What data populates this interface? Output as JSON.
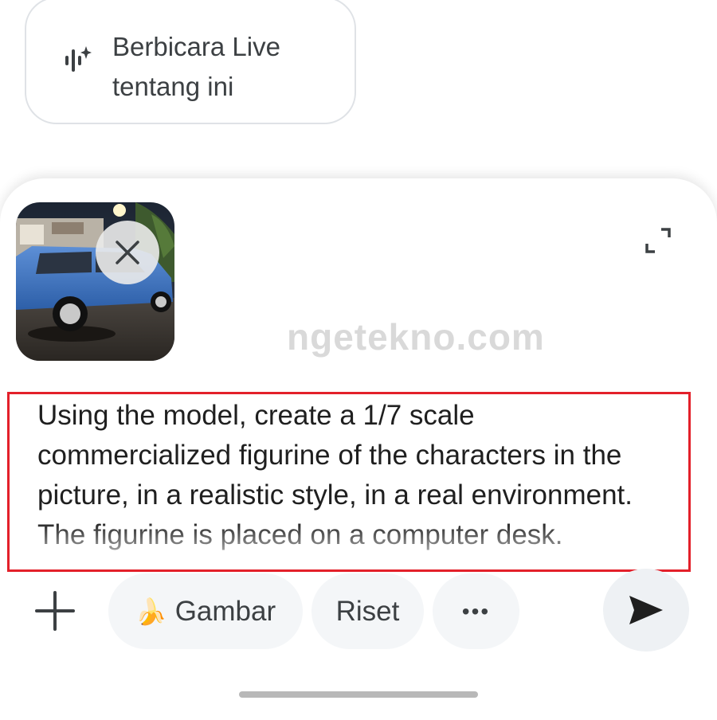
{
  "live_card": {
    "icon": "live-waveform-sparkle-icon",
    "label": "Berbicara Live tentang ini"
  },
  "attachment": {
    "close_icon": "close-icon",
    "image_subject": "blue hatchback car parked at night"
  },
  "expand_icon": "expand-icon",
  "watermark": "ngetekno.com",
  "prompt": {
    "text": "Using the model, create a 1/7 scale commercialized figurine of the characters in the picture, in a realistic style, in a real environment. The figurine is placed on a computer desk."
  },
  "toolbar": {
    "add_icon": "plus-icon",
    "image_chip_emoji": "🍌",
    "image_chip_label": "Gambar",
    "research_chip_label": "Riset",
    "more_label": "•••",
    "send_icon": "send-icon"
  },
  "colors": {
    "highlight_border": "#e3202a",
    "chip_bg": "#f4f6f8",
    "text": "#1f1f1f"
  }
}
